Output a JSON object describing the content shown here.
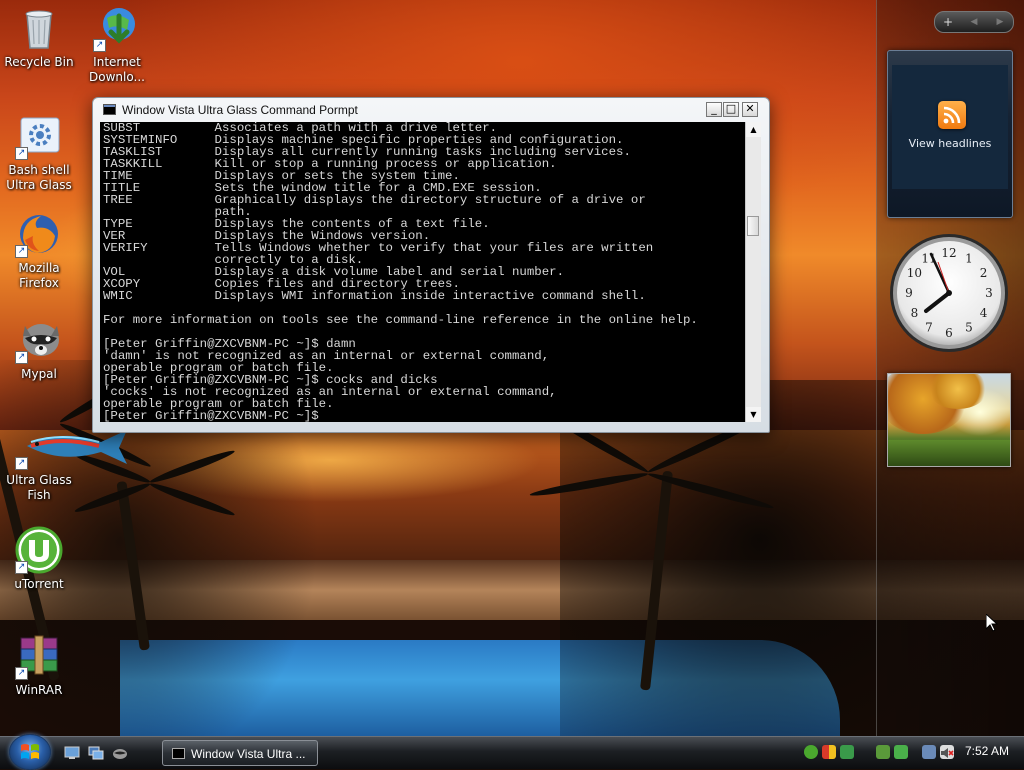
{
  "desktop": {
    "icons": [
      {
        "label": "Recycle Bin",
        "icon": "recycle-bin-icon"
      },
      {
        "label": "Internet Downlo...",
        "icon": "internet-download-manager-icon"
      },
      {
        "label": "Bash shell Ultra Glass",
        "icon": "bash-shell-icon"
      },
      {
        "label": "Mozilla Firefox",
        "icon": "firefox-icon"
      },
      {
        "label": "Mypal",
        "icon": "mypal-raccoon-icon"
      },
      {
        "label": "Ultra Glass Fish",
        "icon": "fish-icon"
      },
      {
        "label": "uTorrent",
        "icon": "utorrent-icon"
      },
      {
        "label": "WinRAR",
        "icon": "winrar-icon"
      }
    ]
  },
  "sidebar": {
    "controls": {
      "add": "+",
      "prev": "◀",
      "next": "▶"
    },
    "feed": {
      "label": "View headlines"
    },
    "clock": {
      "numbers": [
        "12",
        "1",
        "2",
        "3",
        "4",
        "5",
        "6",
        "7",
        "8",
        "9",
        "10",
        "11"
      ]
    }
  },
  "window": {
    "title": "Window Vista Ultra Glass Command Pormpt",
    "buttons": {
      "minimize": "_",
      "maximize": "□",
      "close": "✕"
    },
    "console_lines": [
      "SUBST          Associates a path with a drive letter.",
      "SYSTEMINFO     Displays machine specific properties and configuration.",
      "TASKLIST       Displays all currently running tasks including services.",
      "TASKKILL       Kill or stop a running process or application.",
      "TIME           Displays or sets the system time.",
      "TITLE          Sets the window title for a CMD.EXE session.",
      "TREE           Graphically displays the directory structure of a drive or",
      "               path.",
      "TYPE           Displays the contents of a text file.",
      "VER            Displays the Windows version.",
      "VERIFY         Tells Windows whether to verify that your files are written",
      "               correctly to a disk.",
      "VOL            Displays a disk volume label and serial number.",
      "XCOPY          Copies files and directory trees.",
      "WMIC           Displays WMI information inside interactive command shell.",
      "",
      "For more information on tools see the command-line reference in the online help.",
      "",
      "[Peter Griffin@ZXCVBNM-PC ~]$ damn",
      "'damn' is not recognized as an internal or external command,",
      "operable program or batch file.",
      "[Peter Griffin@ZXCVBNM-PC ~]$ cocks and dicks",
      "'cocks' is not recognized as an internal or external command,",
      "operable program or batch file.",
      "[Peter Griffin@ZXCVBNM-PC ~]$"
    ],
    "scroll": {
      "up": "▲",
      "down": "▼"
    }
  },
  "taskbar": {
    "task_label": "Window Vista Ultra ...",
    "clock": "7:52 AM",
    "quick_launch": [
      "show-desktop-icon",
      "switch-windows-icon",
      "mypal-icon"
    ],
    "tray_icons": [
      "utorrent-tray-icon",
      "security-shield-icon",
      "network-icon",
      "safely-remove-icon",
      "update-icon",
      "display-icon",
      "volume-muted-icon"
    ]
  },
  "colors": {
    "console_bg": "#000000",
    "console_text": "#d8d8d8",
    "accent_orange": "#f07a10"
  }
}
